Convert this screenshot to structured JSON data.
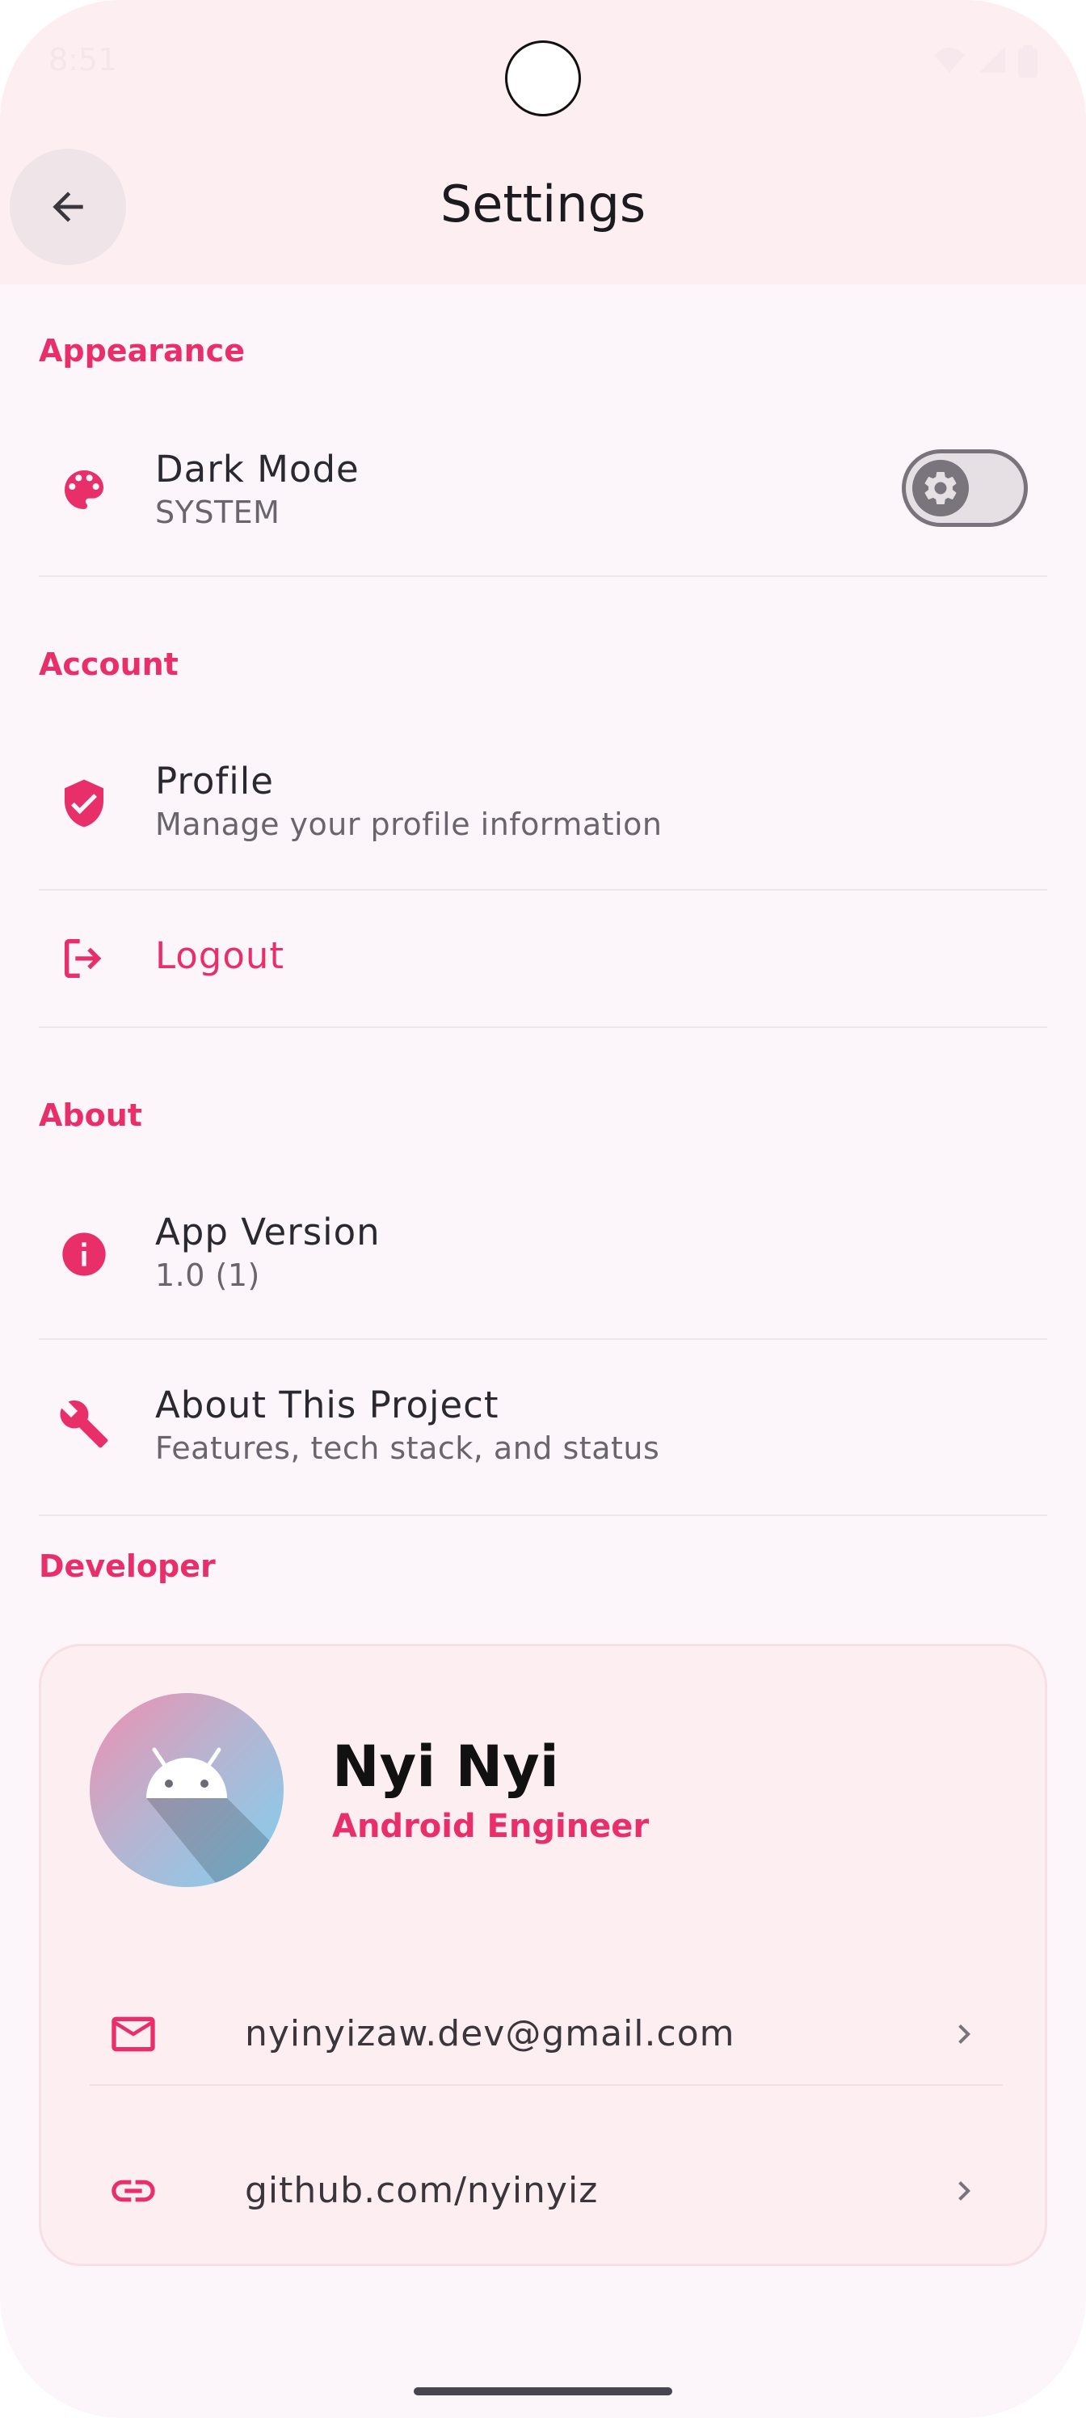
{
  "status_bar": {
    "time": "8:51"
  },
  "appbar": {
    "title": "Settings"
  },
  "sections": {
    "appearance": {
      "header": "Appearance",
      "dark_mode": {
        "title": "Dark Mode",
        "subtitle": "SYSTEM",
        "icon": "palette-icon"
      }
    },
    "account": {
      "header": "Account",
      "profile": {
        "title": "Profile",
        "subtitle": "Manage your profile information",
        "icon": "shield-check-icon"
      },
      "logout": {
        "title": "Logout",
        "icon": "logout-icon"
      }
    },
    "about": {
      "header": "About",
      "app_version": {
        "title": "App Version",
        "subtitle": "1.0 (1)",
        "icon": "info-icon"
      },
      "about_project": {
        "title": "About This Project",
        "subtitle": "Features, tech stack, and status",
        "icon": "wrench-icon"
      }
    },
    "developer": {
      "header": "Developer",
      "name": "Nyi Nyi",
      "role": "Android Engineer",
      "contacts": [
        {
          "label": "nyinyizaw.dev@gmail.com",
          "icon": "mail-icon"
        },
        {
          "label": "github.com/nyinyiz",
          "icon": "link-icon"
        }
      ]
    }
  },
  "colors": {
    "accent": "#e82f6a",
    "background": "#fcf6fa",
    "appbar": "#fdeef2",
    "card": "#fdeef1"
  }
}
